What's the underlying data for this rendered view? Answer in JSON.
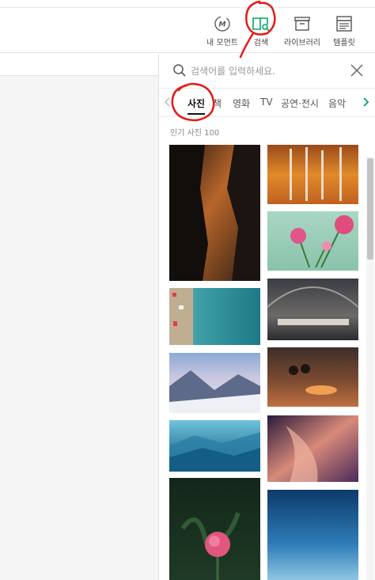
{
  "toolbar": {
    "items": [
      {
        "label": "내 모먼트",
        "icon": "moment-m-icon"
      },
      {
        "label": "검색",
        "icon": "book-search-icon"
      },
      {
        "label": "라이브러리",
        "icon": "archive-box-icon"
      },
      {
        "label": "템플릿",
        "icon": "template-icon"
      }
    ]
  },
  "search": {
    "placeholder": "검색어를 입력하세요.",
    "value": ""
  },
  "tabs": {
    "items": [
      "사진",
      "책",
      "영화",
      "TV",
      "공연·전시",
      "음악"
    ],
    "active": "사진"
  },
  "section": {
    "title": "인기 사진 100"
  },
  "photos": [
    {
      "subject": "climber on desert canyon wall at sunset"
    },
    {
      "subject": "autumn birch forest with orange leaves"
    },
    {
      "subject": "aerial view of turquoise beach and town"
    },
    {
      "subject": "pink flowers on mint background"
    },
    {
      "subject": "snowy forest and mountains at dusk"
    },
    {
      "subject": "grand railway station interior"
    },
    {
      "subject": "layered blue misty mountains"
    },
    {
      "subject": "people around campfire at night"
    },
    {
      "subject": "pink peony bud with dark leaves"
    },
    {
      "subject": "purple slot canyon rock waves"
    },
    {
      "subject": "blue gradient sky"
    }
  ],
  "colors": {
    "accent_green": "#00a862",
    "annotation_red": "#e51a1a",
    "scroll_thumb": "#c4c4c4"
  }
}
